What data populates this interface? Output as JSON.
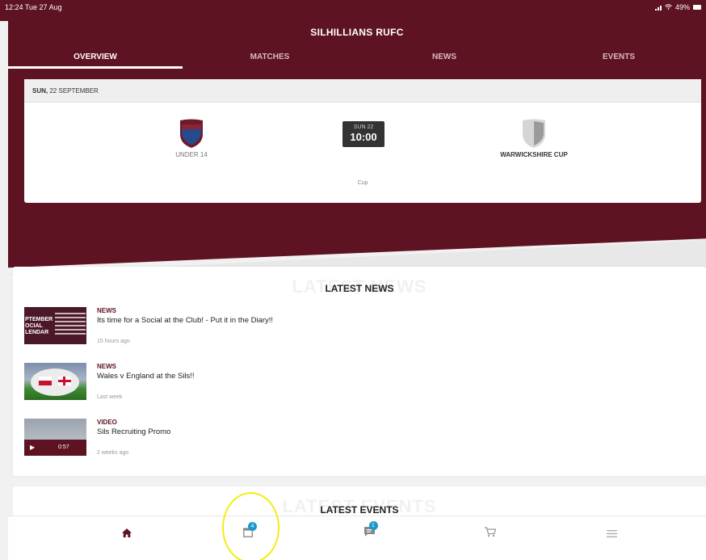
{
  "status_bar": {
    "time": "12:24",
    "date": "Tue 27 Aug",
    "battery": "49%"
  },
  "header": {
    "title": "SILHILLIANS RUFC"
  },
  "tabs": [
    {
      "label": "OVERVIEW",
      "active": true
    },
    {
      "label": "MATCHES",
      "active": false
    },
    {
      "label": "NEWS",
      "active": false
    },
    {
      "label": "EVENTS",
      "active": false
    }
  ],
  "fixture": {
    "date_day": "SUN,",
    "date_rest": "22 SEPTEMBER",
    "home_team": "UNDER 14",
    "away_team": "WARWICKSHIRE CUP",
    "kickoff_day": "SUN 22",
    "kickoff_time": "10:00",
    "competition": "Cup"
  },
  "latest_news": {
    "title": "LATEST NEWS",
    "items": [
      {
        "category": "NEWS",
        "title": "Its time for a Social at the Club! - Put it in the Diary!!",
        "time": "15 hours ago",
        "thumb_text": "PTEMBER\nOCIAL\nLENDAR"
      },
      {
        "category": "NEWS",
        "title": "Wales v England at the Sils!!",
        "time": "Last week"
      },
      {
        "category": "VIDEO",
        "title": "Sils Recruiting Promo",
        "time": "2 weeks ago",
        "duration": "0:57"
      }
    ]
  },
  "latest_events": {
    "title": "LATEST EVENTS"
  },
  "bottom_nav": {
    "items": [
      {
        "icon": "home-icon",
        "active": true
      },
      {
        "icon": "calendar-icon",
        "badge": "4"
      },
      {
        "icon": "chat-icon",
        "badge": "1"
      },
      {
        "icon": "cart-icon"
      },
      {
        "icon": "menu-icon"
      }
    ]
  },
  "colors": {
    "primary": "#5e1322",
    "badge": "#1a98c9",
    "annotation": "#f2ee10"
  }
}
